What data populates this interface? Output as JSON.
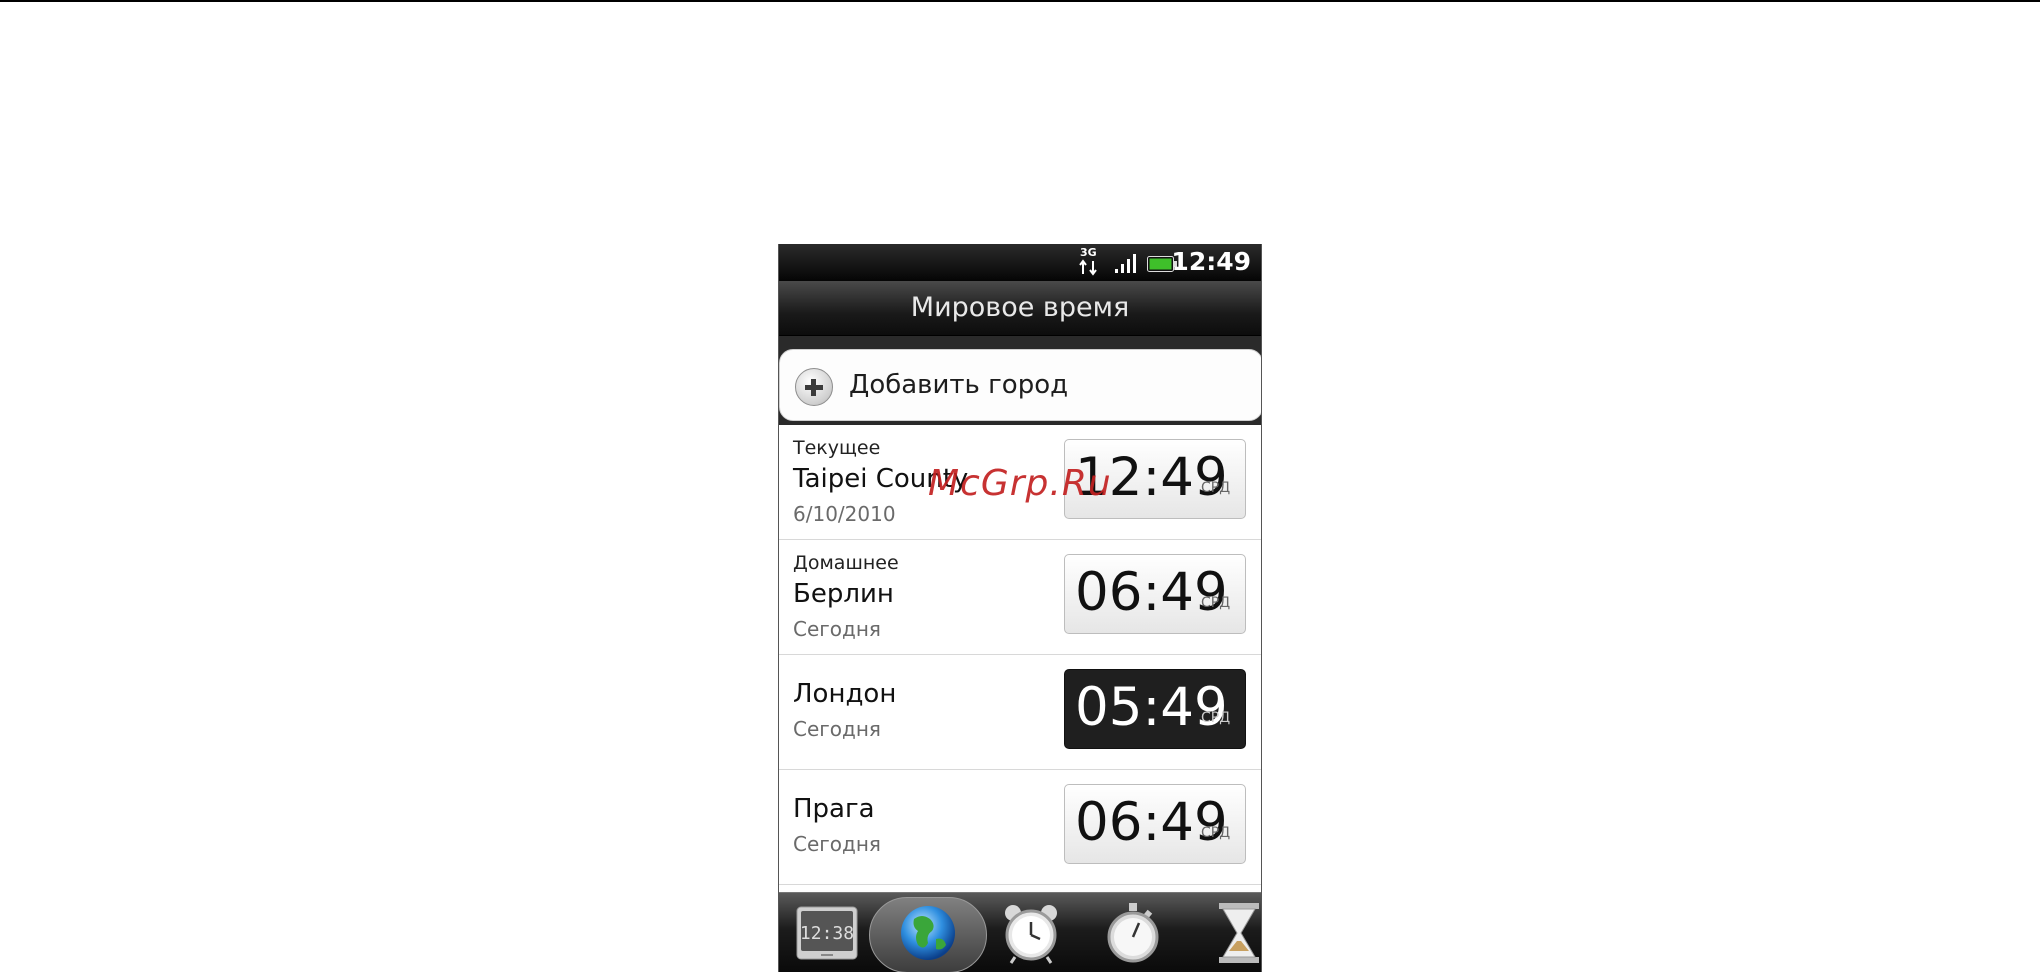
{
  "status_bar": {
    "network_label": "3G",
    "time": "12:49",
    "icons": [
      "3g-data-icon",
      "signal-strength-icon",
      "battery-icon"
    ],
    "battery_color": "#3fbf2a"
  },
  "header": {
    "title": "Мировое время"
  },
  "add_city": {
    "label": "Добавить город",
    "icon": "add-circle-icon"
  },
  "cities": [
    {
      "tag": "Текущее",
      "name": "Taipei County",
      "date": "6/10/2010",
      "time": "12:49",
      "day": "СРД",
      "highlighted": false
    },
    {
      "tag": "Домашнее",
      "name": "Берлин",
      "date": "Сегодня",
      "time": "06:49",
      "day": "СРД",
      "highlighted": false
    },
    {
      "tag": "",
      "name": "Лондон",
      "date": "Сегодня",
      "time": "05:49",
      "day": "СРД",
      "highlighted": true
    },
    {
      "tag": "",
      "name": "Прага",
      "date": "Сегодня",
      "time": "06:49",
      "day": "СРД",
      "highlighted": false
    }
  ],
  "tabs": [
    {
      "name": "desk-clock-tab",
      "icon": "digital-clock-icon",
      "selected": false,
      "label": "12:38"
    },
    {
      "name": "world-clock-tab",
      "icon": "globe-icon",
      "selected": true
    },
    {
      "name": "alarm-tab",
      "icon": "alarm-clock-icon",
      "selected": false
    },
    {
      "name": "stopwatch-tab",
      "icon": "stopwatch-icon",
      "selected": false
    },
    {
      "name": "timer-tab",
      "icon": "hourglass-icon",
      "selected": false
    }
  ],
  "watermark": {
    "text": "McGrp.Ru",
    "color": "#c32121"
  }
}
